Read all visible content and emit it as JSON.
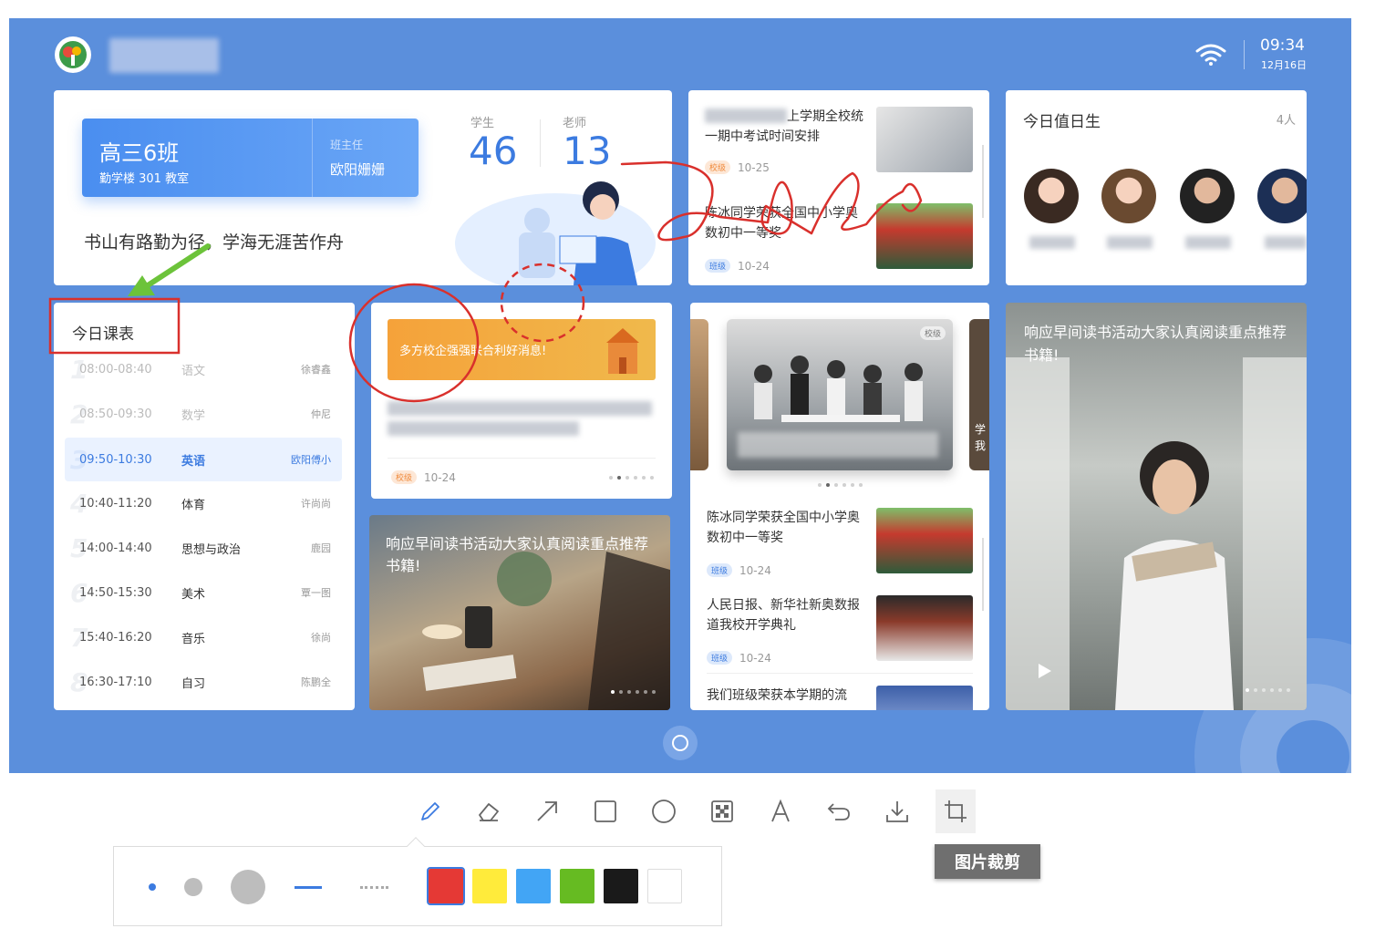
{
  "header": {
    "time": "09:34",
    "date": "12月16日"
  },
  "class_card": {
    "class_name": "高三6班",
    "room": "勤学楼 301 教室",
    "head_teacher_label": "班主任",
    "head_teacher": "欧阳姗姗",
    "motto": "书山有路勤为径，学海无涯苦作舟",
    "students_label": "学生",
    "students_count": "46",
    "teachers_label": "老师",
    "teachers_count": "13"
  },
  "news_top": [
    {
      "title": "上学期全校统一期中考试时间安排",
      "tag": "校级",
      "date": "10-25"
    },
    {
      "title": "陈冰同学荣获全国中小学奥数初中一等奖",
      "tag": "班级",
      "date": "10-24"
    }
  ],
  "duty": {
    "title": "今日值日生",
    "count": "4人"
  },
  "schedule": {
    "title": "今日课表",
    "rows": [
      {
        "num": "1",
        "time": "08:00-08:40",
        "subject": "语文",
        "teacher": "徐睿鑫",
        "state": "past"
      },
      {
        "num": "2",
        "time": "08:50-09:30",
        "subject": "数学",
        "teacher": "仲尼",
        "state": "past"
      },
      {
        "num": "3",
        "time": "09:50-10:30",
        "subject": "英语",
        "teacher": "欧阳傅小",
        "state": "active"
      },
      {
        "num": "4",
        "time": "10:40-11:20",
        "subject": "体育",
        "teacher": "许尚尚",
        "state": "normal"
      },
      {
        "num": "5",
        "time": "14:00-14:40",
        "subject": "思想与政治",
        "teacher": "鹿园",
        "state": "normal"
      },
      {
        "num": "6",
        "time": "14:50-15:30",
        "subject": "美术",
        "teacher": "覃一图",
        "state": "normal"
      },
      {
        "num": "7",
        "time": "15:40-16:20",
        "subject": "音乐",
        "teacher": "徐尚",
        "state": "normal"
      },
      {
        "num": "8",
        "time": "16:30-17:10",
        "subject": "自习",
        "teacher": "陈鹏全",
        "state": "normal"
      }
    ]
  },
  "notice": {
    "banner": "多方校企强强联合利好消息!",
    "tag": "校级",
    "date": "10-24"
  },
  "reading_banner": {
    "text": "响应早间读书活动大家认真阅读重点推荐书籍!"
  },
  "carousel_card": {
    "tag": "校级",
    "side_text": "学我"
  },
  "news_list": [
    {
      "title": "陈冰同学荣获全国中小学奥数初中一等奖",
      "tag": "班级",
      "date": "10-24"
    },
    {
      "title": "人民日报、新华社新奥数报道我校开学典礼",
      "tag": "班级",
      "date": "10-24"
    },
    {
      "title": "我们班级荣获本学期的流"
    }
  ],
  "video_card": {
    "text": "响应早间读书活动大家认真阅读重点推荐书籍!"
  },
  "toolbar": {
    "tools": [
      "pencil-icon",
      "eraser-icon",
      "arrow-icon",
      "rectangle-icon",
      "circle-icon",
      "mosaic-icon",
      "text-icon",
      "undo-icon",
      "download-icon",
      "crop-icon"
    ],
    "tooltip": "图片裁剪",
    "colors": [
      "#e53935",
      "#ffeb3b",
      "#42a5f5",
      "#66bb22",
      "#1a1a1a",
      "#ffffff"
    ],
    "selected_color": "#e53935"
  },
  "annotations": {
    "colors": {
      "red": "#d9302c",
      "green": "#6cc33a"
    }
  }
}
